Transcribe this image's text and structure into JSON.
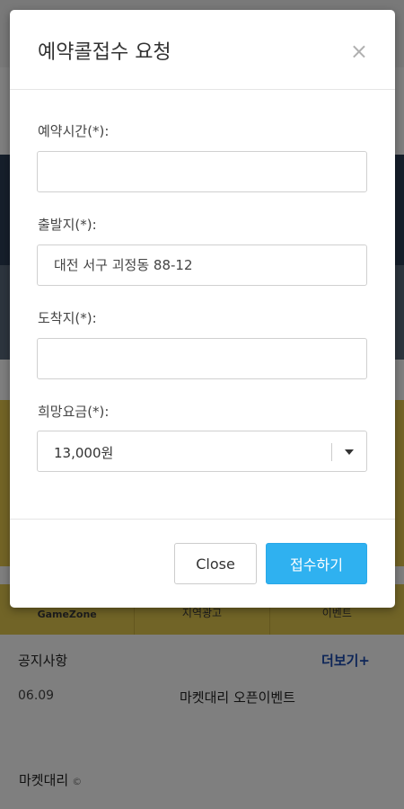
{
  "background": {
    "tabs": [
      "GameZone",
      "지역광고",
      "이벤트"
    ],
    "notice": {
      "title": "공지사항",
      "more": "더보기+",
      "date": "06.09",
      "text": "마켓대리 오픈이벤트"
    },
    "footer": {
      "brand": "마켓대리",
      "copyright": "©"
    }
  },
  "modal": {
    "title": "예약콜접수 요청",
    "close_icon": "×",
    "fields": {
      "reservation_time": {
        "label": "예약시간(*):",
        "value": ""
      },
      "departure": {
        "label": "출발지(*):",
        "value": "대전 서구 괴정동 88-12"
      },
      "destination": {
        "label": "도착지(*):",
        "value": ""
      },
      "fare": {
        "label": "희망요금(*):",
        "value": "13,000원"
      }
    },
    "buttons": {
      "close": "Close",
      "submit": "접수하기"
    }
  },
  "colors": {
    "accent": "#2fb1f0",
    "link": "#1a4bb0",
    "banner": "#e6c94d"
  }
}
